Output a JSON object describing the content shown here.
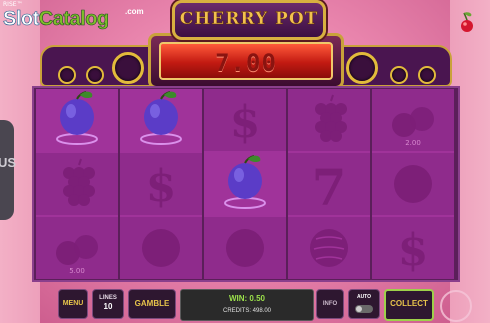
{
  "watermark": {
    "top_text": "RISE™",
    "brand_a": "Slot",
    "brand_b": "Catalog",
    "suffix": ".com"
  },
  "game": {
    "title": "CHERRY POT",
    "win_display": "7.00"
  },
  "side_bonus": {
    "text": "US"
  },
  "reels": [
    {
      "cells": [
        {
          "symbol": "plum",
          "state": "active",
          "label": ""
        },
        {
          "symbol": "grapes",
          "state": "dim",
          "label": ""
        },
        {
          "symbol": "cherry",
          "state": "dim",
          "label": "5.00"
        }
      ]
    },
    {
      "cells": [
        {
          "symbol": "plum",
          "state": "active",
          "label": ""
        },
        {
          "symbol": "dollar",
          "state": "dim",
          "label": ""
        },
        {
          "symbol": "orange",
          "state": "dim",
          "label": ""
        }
      ]
    },
    {
      "cells": [
        {
          "symbol": "dollar",
          "state": "dim",
          "label": ""
        },
        {
          "symbol": "plum",
          "state": "active",
          "label": ""
        },
        {
          "symbol": "orange",
          "state": "dim",
          "label": ""
        }
      ]
    },
    {
      "cells": [
        {
          "symbol": "grapes",
          "state": "dim",
          "label": ""
        },
        {
          "symbol": "seven",
          "state": "dim",
          "label": ""
        },
        {
          "symbol": "watermelon",
          "state": "dim",
          "label": ""
        }
      ]
    },
    {
      "cells": [
        {
          "symbol": "cherry",
          "state": "dim",
          "label": "2.00"
        },
        {
          "symbol": "orange",
          "state": "dim",
          "label": ""
        },
        {
          "symbol": "dollar",
          "state": "dim",
          "label": ""
        }
      ]
    }
  ],
  "controls": {
    "menu": "MENU",
    "lines_label": "LINES",
    "lines_value": "10",
    "gamble": "GAMBLE",
    "win_text": "WIN: 0.50",
    "credits_text": "CREDITS: 498.00",
    "info": "INFO",
    "auto": "AUTO",
    "collect": "COLLECT"
  },
  "colors": {
    "plum": "#5b3cc7",
    "symbol_dim": "#7d1f78",
    "win_green": "#9be14b",
    "gold": "#e7c44b"
  }
}
